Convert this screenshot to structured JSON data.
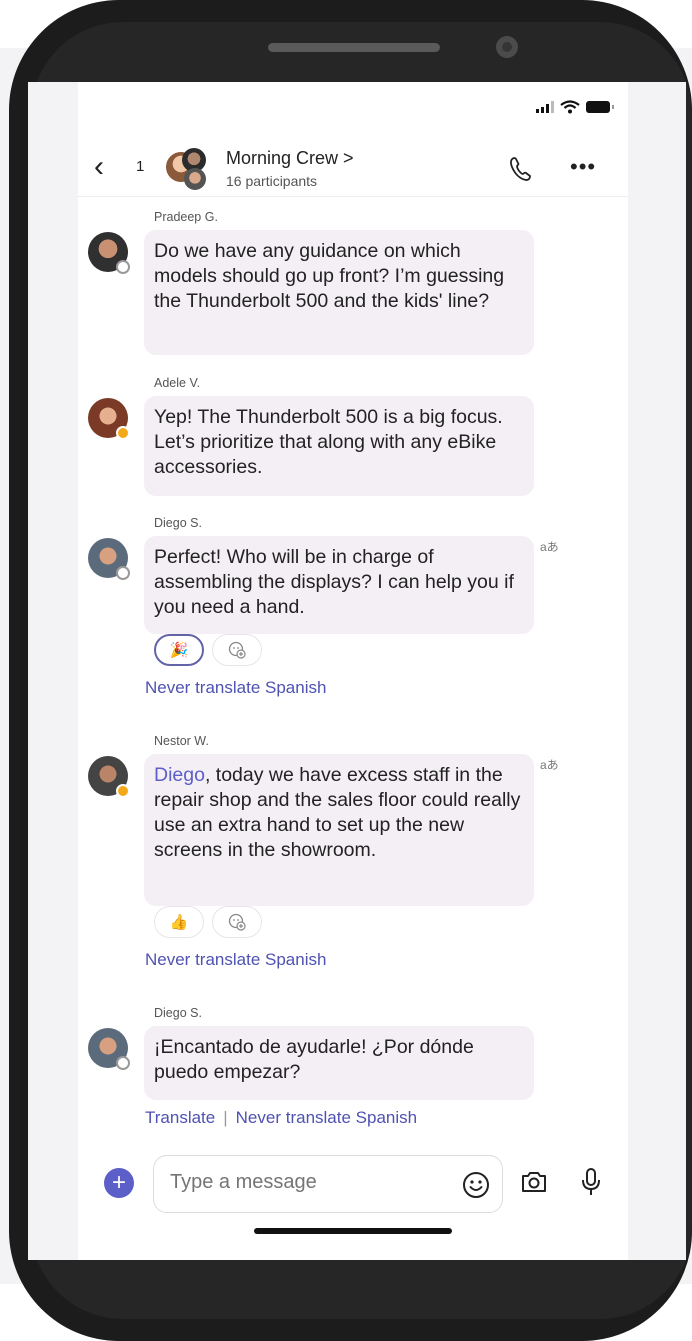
{
  "header": {
    "back_count": "1",
    "title": "Morning Crew >",
    "subtitle": "16 participants"
  },
  "messages": [
    {
      "sender": "Pradeep G.",
      "text": "Do we have any guidance on which models should go up front? I’m guessing the Thunderbolt 500 and the kids' line?"
    },
    {
      "sender": "Adele V.",
      "text": "Yep! The Thunderbolt 500 is a big focus. Let’s prioritize that along with any eBike accessories."
    },
    {
      "sender": "Diego S.",
      "text": "Perfect! Who will be in charge of assembling the displays? I can help you if you need a hand.",
      "translate_icon": "aあ",
      "reaction": "🎉",
      "link": "Never translate Spanish"
    },
    {
      "sender": "Nestor W.",
      "mention": "Diego",
      "text": ", today we have excess staff in the repair shop and the sales floor could really use an extra hand to set up the new screens in the showroom.",
      "translate_icon": "aあ",
      "reaction": "👍",
      "link": "Never translate Spanish"
    },
    {
      "sender": "Diego S.",
      "text": "¡Encantado de ayudarle! ¿Por dónde puedo empezar?",
      "link_translate": "Translate",
      "link_separator": "|",
      "link": "Never translate Spanish"
    }
  ],
  "composer": {
    "placeholder": "Type a message",
    "plus": "+"
  },
  "colors": {
    "accent": "#5b5fc7",
    "bubble": "#f4eff5",
    "link": "#4f52b2"
  }
}
